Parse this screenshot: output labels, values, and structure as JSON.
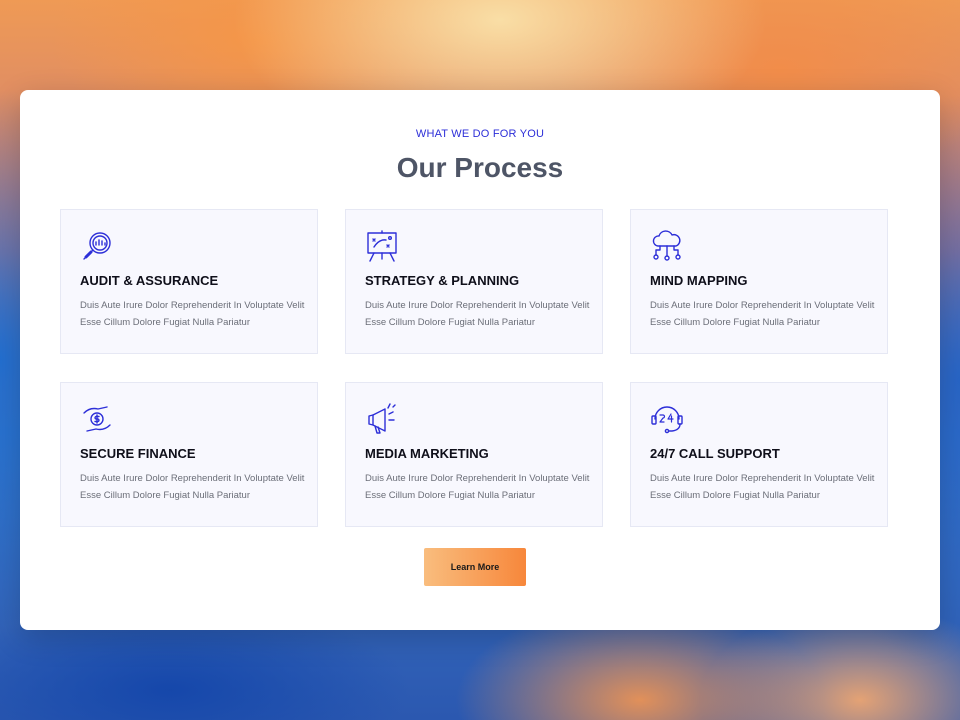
{
  "header": {
    "eyebrow": "WHAT WE DO FOR YOU",
    "title": "Our Process"
  },
  "services": [
    {
      "icon": "audit-magnifier-icon",
      "title": "AUDIT & ASSURANCE",
      "desc": "Duis Aute Irure Dolor Reprehenderit In Voluptate Velit Esse Cillum Dolore Fugiat Nulla Pariatur"
    },
    {
      "icon": "strategy-board-icon",
      "title": "STRATEGY & PLANNING",
      "desc": "Duis Aute Irure Dolor Reprehenderit In Voluptate Velit Esse Cillum Dolore Fugiat Nulla Pariatur"
    },
    {
      "icon": "cloud-network-icon",
      "title": "MIND MAPPING",
      "desc": "Duis Aute Irure Dolor Reprehenderit In Voluptate Velit Esse Cillum Dolore Fugiat Nulla Pariatur"
    },
    {
      "icon": "hand-coin-icon",
      "title": "SECURE FINANCE",
      "desc": "Duis Aute Irure Dolor Reprehenderit In Voluptate Velit Esse Cillum Dolore Fugiat Nulla Pariatur"
    },
    {
      "icon": "megaphone-icon",
      "title": "MEDIA MARKETING",
      "desc": "Duis Aute Irure Dolor Reprehenderit In Voluptate Velit Esse Cillum Dolore Fugiat Nulla Pariatur"
    },
    {
      "icon": "headset-24-icon",
      "title": "24/7 CALL SUPPORT",
      "desc": "Duis Aute Irure Dolor Reprehenderit In Voluptate Velit Esse Cillum Dolore Fugiat Nulla Pariatur"
    }
  ],
  "cta": {
    "label": "Learn More"
  },
  "colors": {
    "accent": "#2d2fd8",
    "title": "#4e5566",
    "button_start": "#f9bd7e",
    "button_end": "#f7873b",
    "card_bg": "#f8f8fe"
  }
}
